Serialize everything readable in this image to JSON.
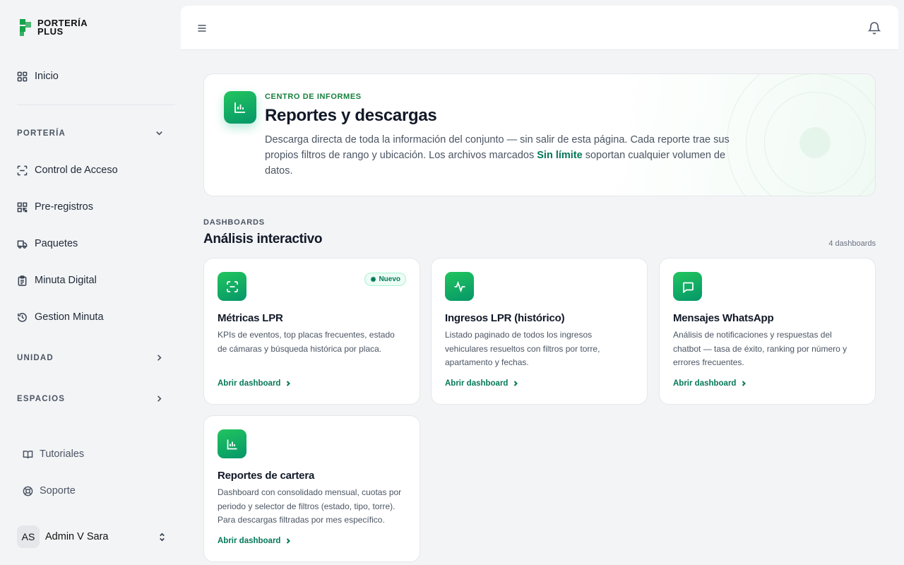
{
  "brand": {
    "line1": "PORTERÍA",
    "line2": "PLUS"
  },
  "sidebar": {
    "home": "Inicio",
    "sections": [
      {
        "label": "PORTERÍA",
        "expanded": true
      },
      {
        "label": "UNIDAD",
        "expanded": false
      },
      {
        "label": "ESPACIOS",
        "expanded": false
      }
    ],
    "porteria_items": [
      "Control de Acceso",
      "Pre-registros",
      "Paquetes",
      "Minuta Digital",
      "Gestion Minuta"
    ],
    "footer": [
      "Tutoriales",
      "Soporte"
    ],
    "user": {
      "initials": "AS",
      "name": "Admin V Sara"
    }
  },
  "hero": {
    "eyebrow": "CENTRO DE INFORMES",
    "title": "Reportes y descargas",
    "desc_before": "Descarga directa de toda la información del conjunto — sin salir de esta página. Cada reporte trae sus propios filtros de rango y ubicación. Los archivos marcados ",
    "desc_highlight": "Sin límite",
    "desc_after": " soportan cualquier volumen de datos."
  },
  "dashboards": {
    "eyebrow": "DASHBOARDS",
    "title": "Análisis interactivo",
    "count": "4 dashboards",
    "cards": [
      {
        "title": "Métricas LPR",
        "desc": "KPIs de eventos, top placas frecuentes, estado de cámaras y búsqueda histórica por placa.",
        "link": "Abrir dashboard",
        "badge": "Nuevo"
      },
      {
        "title": "Ingresos LPR (histórico)",
        "desc": "Listado paginado de todos los ingresos vehiculares resueltos con filtros por torre, apartamento y fechas.",
        "link": "Abrir dashboard"
      },
      {
        "title": "Mensajes WhatsApp",
        "desc": "Análisis de notificaciones y respuestas del chatbot — tasa de éxito, ranking por número y errores frecuentes.",
        "link": "Abrir dashboard"
      },
      {
        "title": "Reportes de cartera",
        "desc": "Dashboard con consolidado mensual, cuotas por periodo y selector de filtros (estado, tipo, torre). Para descargas filtradas por mes específico.",
        "link": "Abrir dashboard"
      }
    ]
  },
  "colors": {
    "accent": "#16a34a",
    "accent_dark": "#047857",
    "background": "#f3f4f6"
  }
}
